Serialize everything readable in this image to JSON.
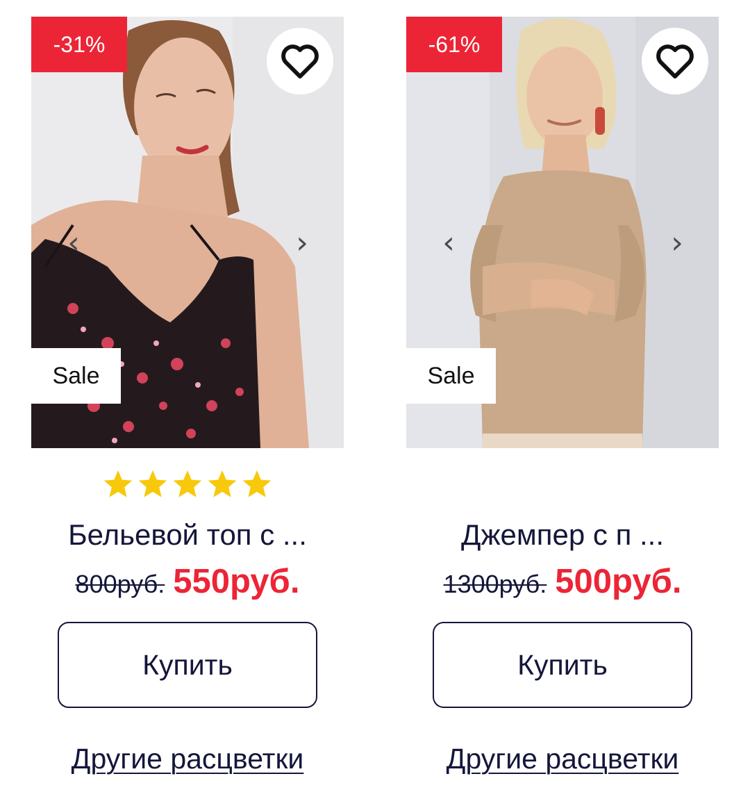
{
  "products": [
    {
      "discount": "-31%",
      "badge": "Sale",
      "title": "Бельевой топ с ...",
      "old_price": "800руб.",
      "new_price": "550руб.",
      "rating": 5,
      "buy_label": "Купить",
      "colors_link": "Другие расцветки",
      "icons": {
        "favorite": "heart-icon",
        "prev": "chevron-left-icon",
        "next": "chevron-right-icon",
        "rating": "star-icon"
      }
    },
    {
      "discount": "-61%",
      "badge": "Sale",
      "title": "Джемпер с п ...",
      "old_price": "1300руб.",
      "new_price": "500руб.",
      "buy_label": "Купить",
      "colors_link": "Другие расцветки",
      "icons": {
        "favorite": "heart-icon",
        "prev": "chevron-left-icon",
        "next": "chevron-right-icon"
      }
    }
  ],
  "colors": {
    "accent": "#ec2536",
    "text": "#14163a",
    "star": "#f7c90a",
    "background": "#ffffff"
  },
  "arrows": {
    "prev": "‹",
    "next": "›"
  }
}
